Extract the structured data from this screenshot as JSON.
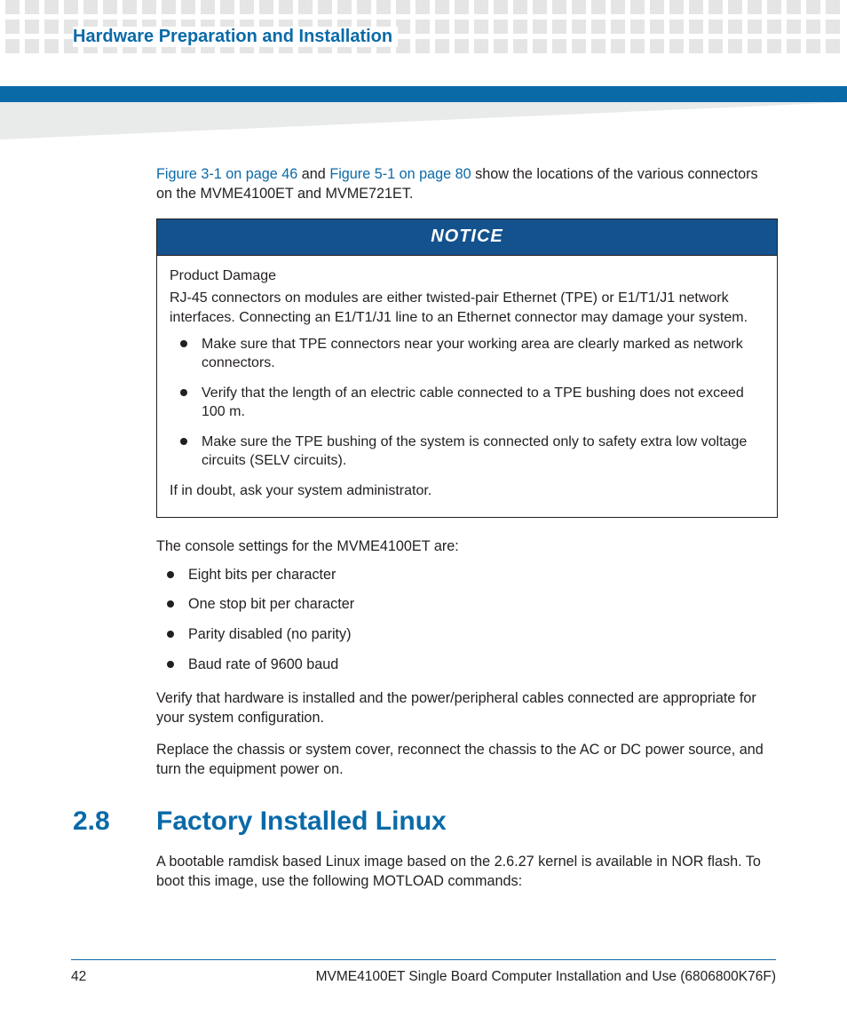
{
  "header": {
    "title": "Hardware Preparation and Installation"
  },
  "intro": {
    "link1": "Figure 3-1 on page 46",
    "mid": " and ",
    "link2": "Figure 5-1 on page 80",
    "tail": " show the locations of the various connectors on the MVME4100ET and MVME721ET."
  },
  "notice": {
    "head": "NOTICE",
    "p1": "Product Damage",
    "p2": "RJ-45 connectors on modules are either twisted-pair Ethernet (TPE) or E1/T1/J1 network interfaces. Connecting an E1/T1/J1 line to an Ethernet connector may damage your system.",
    "bullets": [
      "Make sure that TPE connectors near your working area are clearly marked as network connectors.",
      "Verify that the length of an electric cable connected to a TPE bushing does not exceed 100 m.",
      "Make sure the TPE bushing of the system is connected only to safety extra low voltage circuits (SELV circuits)."
    ],
    "tail": "If in doubt, ask your system administrator."
  },
  "console": {
    "intro": "The console settings for the MVME4100ET are:",
    "items": [
      "Eight bits per character",
      "One stop bit per character",
      "Parity disabled (no parity)",
      "Baud rate of 9600 baud"
    ]
  },
  "para_verify": "Verify that hardware is installed and the power/peripheral cables connected are appropriate for your system configuration.",
  "para_replace": "Replace the chassis or system cover, reconnect the chassis to the AC or DC power source, and turn the equipment power on.",
  "section": {
    "num": "2.8",
    "title": "Factory Installed Linux",
    "body": "A bootable ramdisk based Linux image based on the 2.6.27 kernel is available in NOR flash. To boot this image, use the following MOTLOAD commands:"
  },
  "footer": {
    "page": "42",
    "doc": "MVME4100ET Single Board Computer Installation and Use (6806800K76F)"
  }
}
